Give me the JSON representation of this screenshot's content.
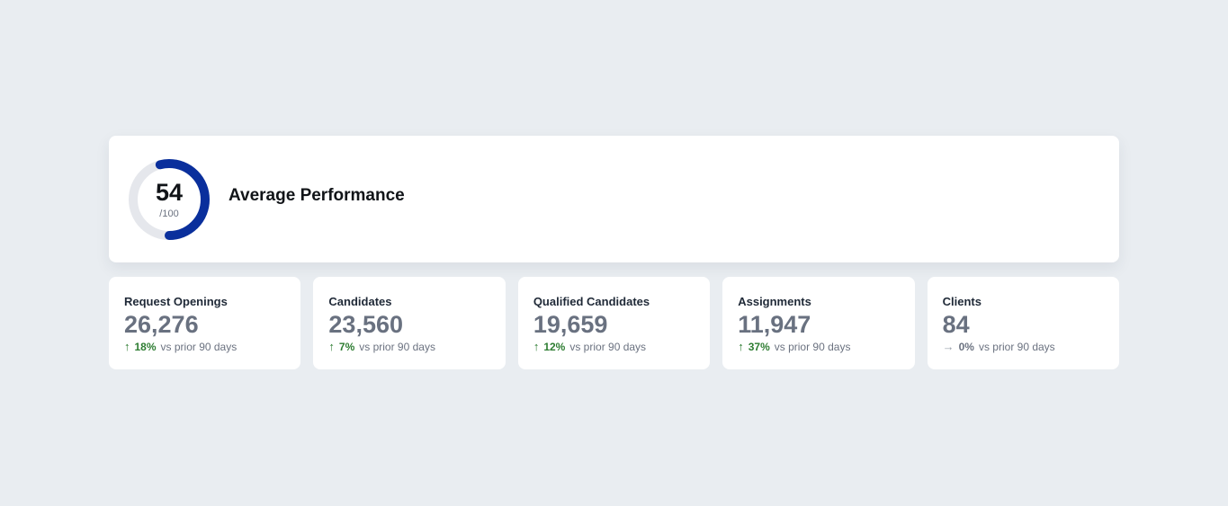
{
  "performance": {
    "score": "54",
    "max": "/100",
    "progress": 0.54,
    "title": "Average Performance",
    "colors": {
      "accent": "#0a2f9c",
      "track": "#e5e7ec"
    }
  },
  "stats": [
    {
      "label": "Request Openings",
      "value": "26,276",
      "arrow": "↑",
      "delta": "18%",
      "trend": "up",
      "suffix": "vs prior 90 days"
    },
    {
      "label": "Candidates",
      "value": "23,560",
      "arrow": "↑",
      "delta": "7%",
      "trend": "up",
      "suffix": "vs prior 90 days"
    },
    {
      "label": "Qualified Candidates",
      "value": "19,659",
      "arrow": "↑",
      "delta": "12%",
      "trend": "up",
      "suffix": "vs prior 90 days"
    },
    {
      "label": "Assignments",
      "value": "11,947",
      "arrow": "↑",
      "delta": "37%",
      "trend": "up",
      "suffix": "vs prior 90 days"
    },
    {
      "label": "Clients",
      "value": "84",
      "arrow": "→",
      "delta": "0%",
      "trend": "flat",
      "suffix": "vs prior 90 days"
    }
  ],
  "colors": {
    "positive": "#2e7d32",
    "neutral": "#6b7280",
    "background": "#e9edf1"
  }
}
